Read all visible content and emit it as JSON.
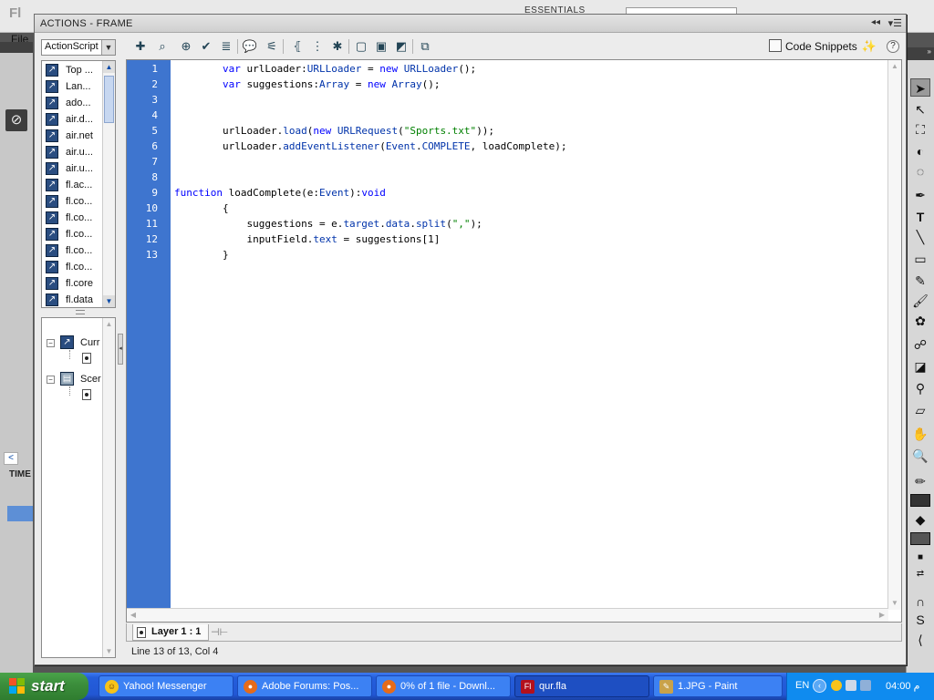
{
  "background": {
    "file_menu": "File",
    "workspace_label": "ESSENTIALS",
    "timeline_label": "TIME"
  },
  "window": {
    "title": "ACTIONS - FRAME"
  },
  "script_language": {
    "selected": "ActionScript"
  },
  "toolbox": {
    "items": [
      {
        "label": "Top ..."
      },
      {
        "label": "Lan..."
      },
      {
        "label": "ado..."
      },
      {
        "label": "air.d..."
      },
      {
        "label": "air.net"
      },
      {
        "label": "air.u..."
      },
      {
        "label": "air.u..."
      },
      {
        "label": "fl.ac..."
      },
      {
        "label": "fl.co..."
      },
      {
        "label": "fl.co..."
      },
      {
        "label": "fl.co..."
      },
      {
        "label": "fl.co..."
      },
      {
        "label": "fl.co..."
      },
      {
        "label": "fl.core"
      },
      {
        "label": "fl.data"
      }
    ]
  },
  "script_navigator": {
    "current_selection": "Curr",
    "scene": "Scer"
  },
  "toolbar": {
    "code_snippets": "Code Snippets",
    "icons": [
      "add-statement-icon",
      "find-icon",
      "insert-target-path-icon",
      "check-syntax-icon",
      "auto-format-icon",
      "show-code-hint-icon",
      "debug-options-icon",
      "collapse-between-braces-icon",
      "collapse-selection-icon",
      "expand-all-icon",
      "apply-block-comment-icon",
      "apply-line-comment-icon",
      "remove-comment-icon",
      "show-hide-toolbox-icon"
    ]
  },
  "editor": {
    "line_numbers": [
      "1",
      "2",
      "3",
      "4",
      "5",
      "6",
      "7",
      "8",
      "9",
      "10",
      "11",
      "12",
      "13"
    ],
    "lines": [
      [
        {
          "t": "        "
        },
        {
          "t": "var",
          "c": "kw"
        },
        {
          "t": " urlLoader:"
        },
        {
          "t": "URLLoader",
          "c": "ty"
        },
        {
          "t": " = "
        },
        {
          "t": "new",
          "c": "kw"
        },
        {
          "t": " "
        },
        {
          "t": "URLLoader",
          "c": "ty"
        },
        {
          "t": "();"
        }
      ],
      [
        {
          "t": "        "
        },
        {
          "t": "var",
          "c": "kw"
        },
        {
          "t": " suggestions:"
        },
        {
          "t": "Array",
          "c": "ty"
        },
        {
          "t": " = "
        },
        {
          "t": "new",
          "c": "kw"
        },
        {
          "t": " "
        },
        {
          "t": "Array",
          "c": "ty"
        },
        {
          "t": "();"
        }
      ],
      [],
      [],
      [
        {
          "t": "        urlLoader."
        },
        {
          "t": "load",
          "c": "ty"
        },
        {
          "t": "("
        },
        {
          "t": "new",
          "c": "kw"
        },
        {
          "t": " "
        },
        {
          "t": "URLRequest",
          "c": "ty"
        },
        {
          "t": "("
        },
        {
          "t": "\"Sports.txt\"",
          "c": "str"
        },
        {
          "t": "));"
        }
      ],
      [
        {
          "t": "        urlLoader."
        },
        {
          "t": "addEventListener",
          "c": "ty"
        },
        {
          "t": "("
        },
        {
          "t": "Event",
          "c": "ty"
        },
        {
          "t": "."
        },
        {
          "t": "COMPLETE",
          "c": "ty"
        },
        {
          "t": ", loadComplete);"
        }
      ],
      [],
      [],
      [
        {
          "t": "function",
          "c": "kw"
        },
        {
          "t": " loadComplete(e:"
        },
        {
          "t": "Event",
          "c": "ty"
        },
        {
          "t": "):"
        },
        {
          "t": "void",
          "c": "kw"
        }
      ],
      [
        {
          "t": "        {"
        }
      ],
      [
        {
          "t": "            suggestions = e."
        },
        {
          "t": "target",
          "c": "ty"
        },
        {
          "t": "."
        },
        {
          "t": "data",
          "c": "ty"
        },
        {
          "t": "."
        },
        {
          "t": "split",
          "c": "ty"
        },
        {
          "t": "("
        },
        {
          "t": "\",\"",
          "c": "str"
        },
        {
          "t": ");"
        }
      ],
      [
        {
          "t": "            inputField."
        },
        {
          "t": "text",
          "c": "ty"
        },
        {
          "t": " = suggestions[1]"
        }
      ],
      [
        {
          "t": "        }"
        }
      ]
    ]
  },
  "layer_tab": {
    "label": "Layer 1 : 1"
  },
  "status": {
    "text": "Line 13 of 13, Col 4"
  },
  "taskbar": {
    "start_label": "start",
    "tasks": [
      {
        "label": "Yahoo! Messenger"
      },
      {
        "label": "Adobe Forums: Pos..."
      },
      {
        "label": "0% of 1 file - Downl..."
      },
      {
        "label": "qur.fla"
      },
      {
        "label": "1.JPG - Paint"
      }
    ],
    "language": "EN",
    "clock": "04:00 م"
  },
  "colors": {
    "gutter": "#3e75cf",
    "keyword": "#0000ff",
    "type": "#0033aa",
    "string": "#008000",
    "taskbar": "#245edb"
  }
}
